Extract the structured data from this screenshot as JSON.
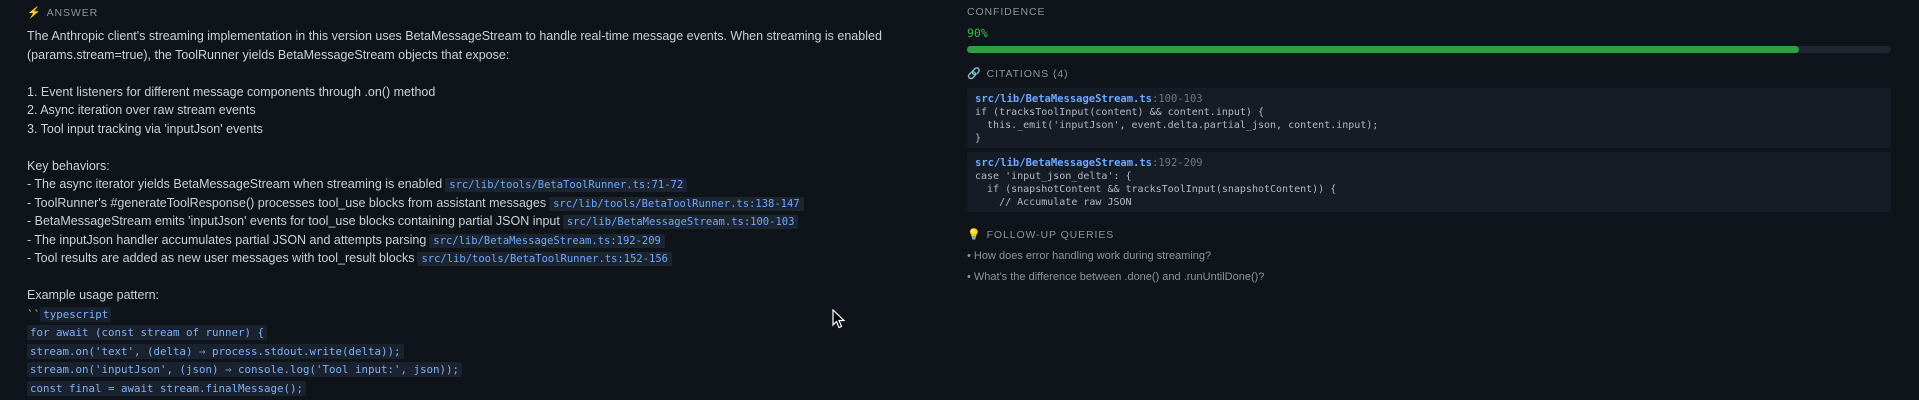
{
  "answer": {
    "title": "ANSWER",
    "lines": [
      {
        "text": "The Anthropic client's streaming implementation in this version uses BetaMessageStream to handle real-time message events. When streaming is enabled"
      },
      {
        "text": "(params.stream=true), the ToolRunner yields BetaMessageStream objects that expose:"
      },
      {
        "text": ""
      },
      {
        "text": "1. Event listeners for different message components through .on() method"
      },
      {
        "text": "2. Async iteration over raw stream events"
      },
      {
        "text": "3. Tool input tracking via 'inputJson' events"
      },
      {
        "text": ""
      },
      {
        "text": "Key behaviors:"
      },
      {
        "text": "- The async iterator yields BetaMessageStream when streaming is enabled",
        "cite": "src/lib/tools/BetaToolRunner.ts:71-72"
      },
      {
        "text": "- ToolRunner's #generateToolResponse() processes tool_use blocks from assistant messages",
        "cite": "src/lib/tools/BetaToolRunner.ts:138-147"
      },
      {
        "text": "- BetaMessageStream emits 'inputJson' events for tool_use blocks containing partial JSON input",
        "cite": "src/lib/BetaMessageStream.ts:100-103"
      },
      {
        "text": "- The inputJson handler accumulates partial JSON and attempts parsing",
        "cite": "src/lib/BetaMessageStream.ts:192-209"
      },
      {
        "text": "- Tool results are added as new user messages with tool_result blocks",
        "cite": "src/lib/tools/BetaToolRunner.ts:152-156"
      },
      {
        "text": ""
      },
      {
        "text": "Example usage pattern:"
      }
    ],
    "code_fence_ticks": "``",
    "code_fence_lang": "typescript",
    "code_lines": [
      "for await (const stream of runner) {",
      "stream.on('text', (delta) ⇒ process.stdout.write(delta));",
      "stream.on('inputJson', (json) ⇒ console.log('Tool input:', json));",
      "const final = await stream.finalMessage();"
    ]
  },
  "confidence": {
    "title": "CONFIDENCE",
    "value_label": "90%",
    "value": 0.9
  },
  "citations": {
    "title": "CITATIONS (4)",
    "items": [
      {
        "file": "src/lib/BetaMessageStream.ts",
        "lines": ":100-103",
        "code": "if (tracksToolInput(content) && content.input) {\n  this._emit('inputJson', event.delta.partial_json, content.input);\n}"
      },
      {
        "file": "src/lib/BetaMessageStream.ts",
        "lines": ":192-209",
        "code": "case 'input_json_delta': {\n  if (snapshotContent && tracksToolInput(snapshotContent)) {\n    // Accumulate raw JSON"
      }
    ]
  },
  "followups": {
    "title": "FOLLOW-UP QUERIES",
    "items": [
      "• How does error handling work during streaming?",
      "• What's the difference between .done() and .runUntilDone()?"
    ]
  },
  "colors": {
    "background": "#0f141b",
    "accent_link": "#6ea8fe",
    "confidence_green": "#2ea043",
    "icon_yellow": "#e3b341"
  }
}
